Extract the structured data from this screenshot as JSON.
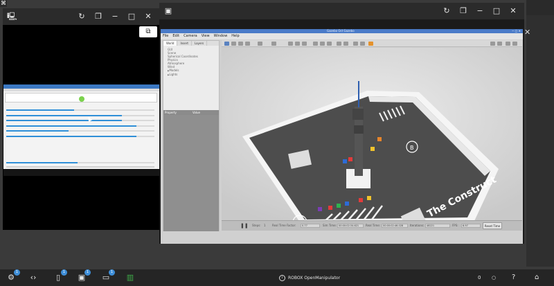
{
  "desktop": {
    "corner_icon": "terminal-icon"
  },
  "left_window": {
    "title_icon": "laptop-icon",
    "controls": [
      "refresh-icon",
      "restore-icon",
      "minimize-icon",
      "maximize-icon",
      "close-icon"
    ],
    "float_button_icon": "picture-in-picture-icon",
    "thumbnail": {
      "sliders": [
        0.46,
        0.78,
        0.78,
        0.88,
        0.42,
        0.88
      ],
      "status_slider": 0.48
    }
  },
  "right_window": {
    "title_icon": "cube-icon",
    "controls": [
      "refresh-icon",
      "restore-icon",
      "minimize-icon",
      "maximize-icon",
      "close-icon"
    ],
    "gazebo": {
      "title": "Gazebo Oct Gazebo",
      "menus": [
        "File",
        "Edit",
        "Camera",
        "View",
        "Window",
        "Help"
      ],
      "tabs": [
        "World",
        "Insert",
        "Layers"
      ],
      "tree": [
        "GUI",
        "Scene",
        "Spherical Coordinates",
        "Physics",
        "Atmosphere",
        "Wind",
        "Models",
        "Lights"
      ],
      "tree_expandable": [
        false,
        false,
        false,
        false,
        false,
        false,
        true,
        true
      ],
      "props_headers": [
        "Property",
        "Value"
      ],
      "bottom": {
        "steps_label": "Steps:",
        "steps_value": "1",
        "rtf_label": "Real Time Factor:",
        "rtf_value": "0.77",
        "sim_label": "Sim Time:",
        "sim_value": "00:00:02:34.621",
        "real_label": "Real Time:",
        "real_value": "00:00:02:46.028",
        "iter_label": "Iterations:",
        "iter_value": "48221",
        "fps_label": "FPS:",
        "fps_value": "6.97",
        "reset_label": "Reset Time"
      },
      "scene": {
        "label_a": "A",
        "label_b": "B",
        "brand": "The Construct"
      }
    }
  },
  "right_strip": {
    "close_glyph": "✕"
  },
  "taskbar": {
    "icons": [
      {
        "name": "robot-icon",
        "badge": "1"
      },
      {
        "name": "code-icon",
        "badge": ""
      },
      {
        "name": "notebook-icon",
        "badge": "1"
      },
      {
        "name": "cube-icon",
        "badge": "1"
      },
      {
        "name": "laptop-icon",
        "badge": "1"
      },
      {
        "name": "book-icon",
        "badge": ""
      }
    ],
    "title": "ROBOX OpenManipulator",
    "right": {
      "zero": "0",
      "help": "?",
      "home_icon": "home-icon"
    }
  }
}
